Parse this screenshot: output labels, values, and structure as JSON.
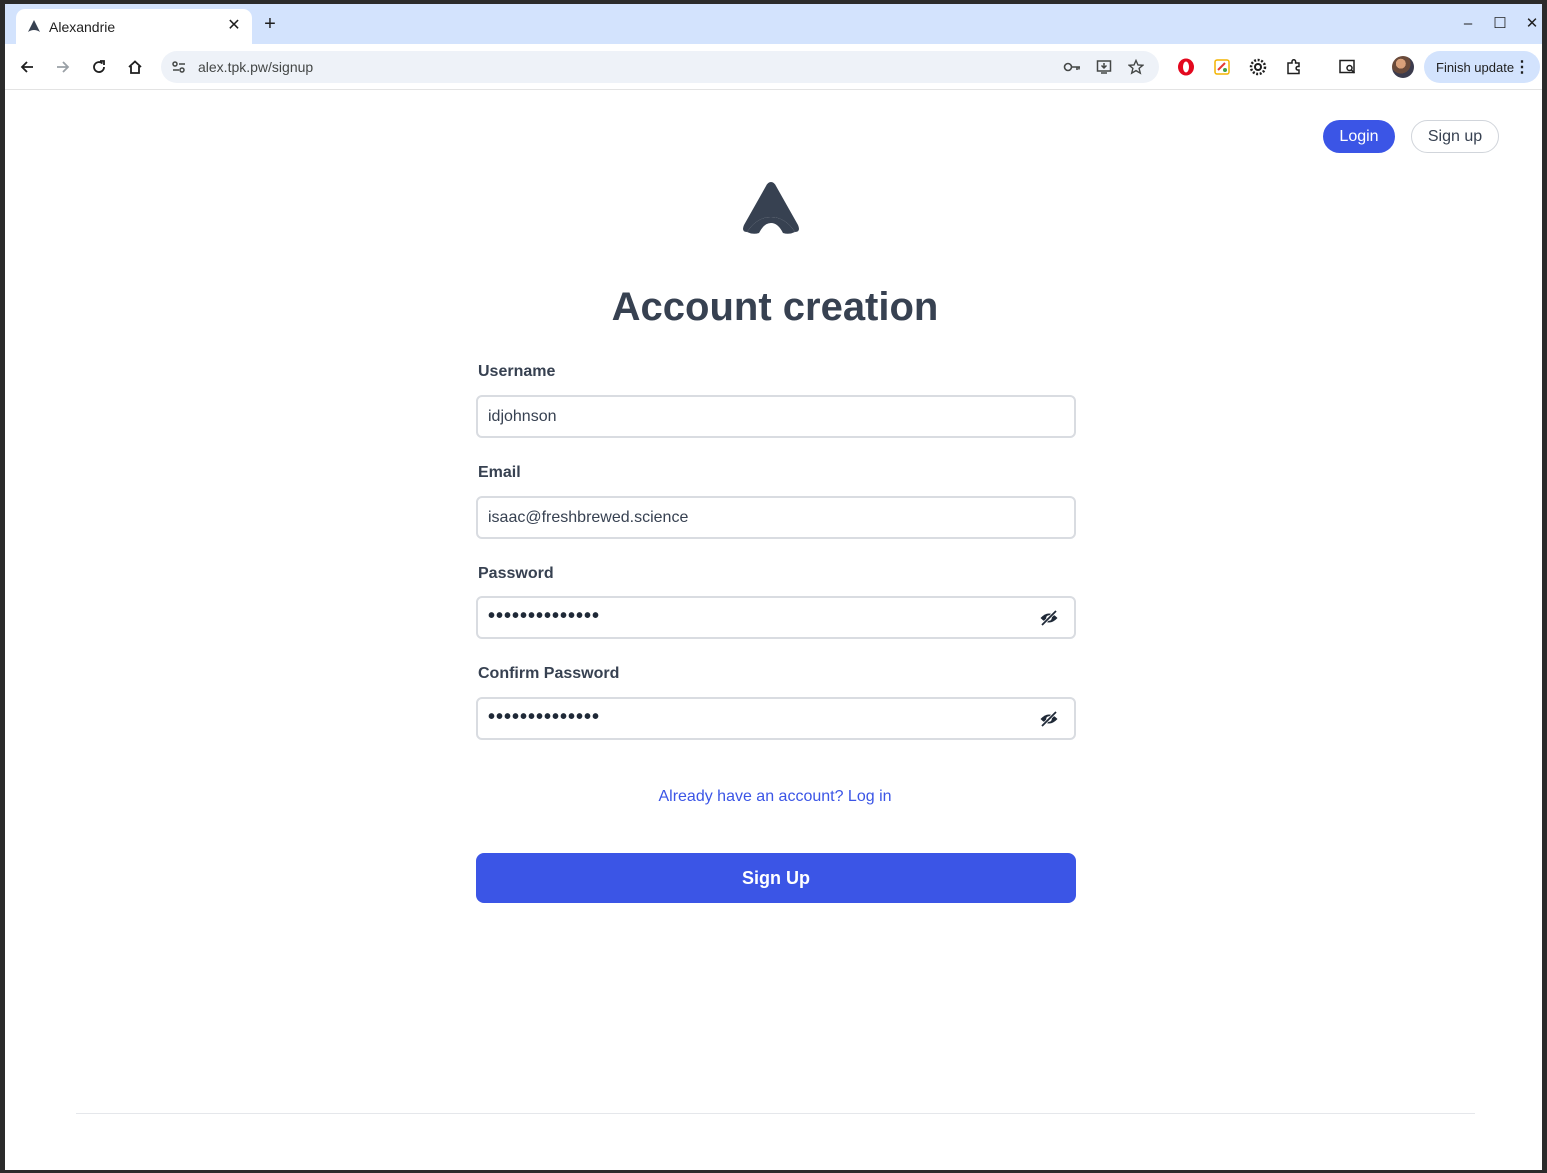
{
  "browser": {
    "tab_title": "Alexandrie",
    "tab_close": "✕",
    "new_tab": "+",
    "url": "alex.tpk.pw/signup",
    "update_label": "Finish update",
    "update_menu": "⋮",
    "window_controls": {
      "minimize": "–",
      "maximize": "☐",
      "close": "✕"
    }
  },
  "header": {
    "login_label": "Login",
    "signup_label": "Sign up"
  },
  "form": {
    "title": "Account creation",
    "username": {
      "label": "Username",
      "value": "idjohnson"
    },
    "email": {
      "label": "Email",
      "value": "isaac@freshbrewed.science"
    },
    "password": {
      "label": "Password",
      "value": "••••••••••••••"
    },
    "confirm_password": {
      "label": "Confirm Password",
      "value": "••••••••••••••"
    },
    "login_link": "Already have an account? Log in",
    "submit_label": "Sign Up"
  },
  "colors": {
    "accent": "#3b55e6",
    "text": "#374151",
    "chrome_tabstrip": "#d3e3fd"
  },
  "icons": [
    "logo-icon",
    "back-icon",
    "forward-icon",
    "reload-icon",
    "home-icon",
    "site-settings-icon",
    "password-key-icon",
    "install-app-icon",
    "bookmark-star-icon",
    "opera-extension-icon",
    "color-extension-icon",
    "gear-extension-icon",
    "extensions-puzzle-icon",
    "tab-search-icon",
    "eye-off-icon"
  ]
}
